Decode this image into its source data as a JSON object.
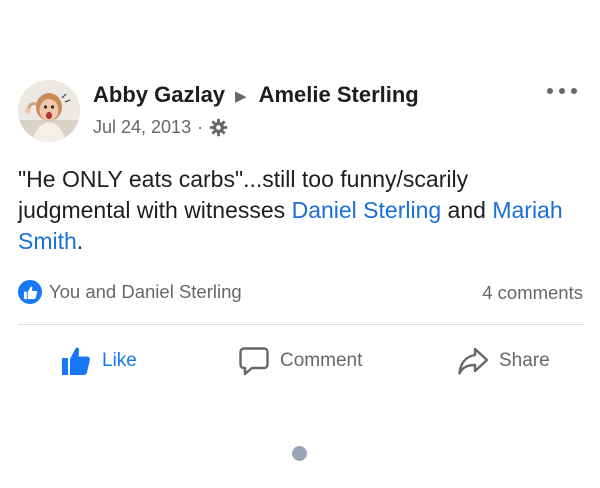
{
  "post": {
    "author": "Abby Gazlay",
    "separator_arrow": "▶",
    "recipient": "Amelie Sterling",
    "date": "Jul 24, 2013",
    "meta_dot": "·",
    "privacy_icon": "gear-icon",
    "options_icon": "more-dots-icon",
    "text_before": "\"He ONLY eats carbs\"...still too funny/scarily judgmental with witnesses ",
    "mention_1": "Daniel Sterling",
    "text_between": " and ",
    "mention_2": "Mariah Smith",
    "text_after": "."
  },
  "engagement": {
    "reactions_text": "You and Daniel Sterling",
    "comments_text": "4 comments",
    "reaction_icon": "like-icon"
  },
  "actions": {
    "like_label": "Like",
    "comment_label": "Comment",
    "share_label": "Share"
  },
  "colors": {
    "link_blue": "#1a6ed8",
    "like_blue": "#1877f2",
    "secondary_text": "#65676b",
    "page_indicator": "#9aa6b8"
  }
}
